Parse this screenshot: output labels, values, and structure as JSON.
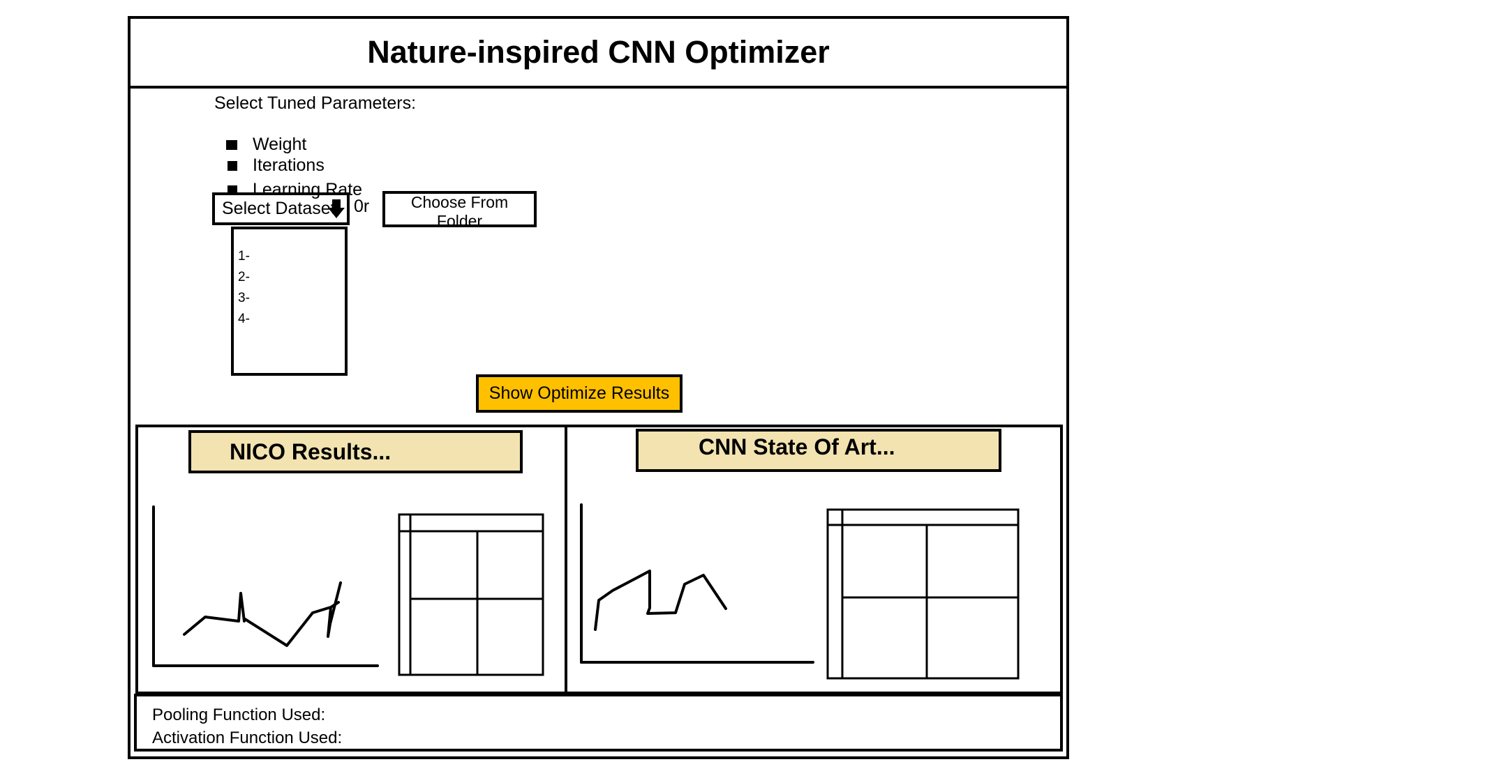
{
  "title": "Nature-inspired CNN Optimizer",
  "params": {
    "label": "Select Tuned Parameters:",
    "items": [
      "Weight",
      "Iterations",
      "Learning Rate"
    ]
  },
  "dataset": {
    "select_label": "Select Dataset",
    "or_text": "0r",
    "folder_button": "Choose From Folder",
    "options": [
      "1-",
      "2-",
      "3-",
      "4-"
    ]
  },
  "show_button": "Show Optimize Results",
  "colors": {
    "button": "#ffc000",
    "header": "#f2e3b0"
  },
  "results": {
    "left_header": "NICO Results...",
    "right_header": "CNN State Of Art..."
  },
  "info": {
    "pooling_label": "Pooling Function Used:",
    "activation_label": "Activation Function Used:"
  },
  "icons": {
    "dropdown": "arrow-down-icon"
  }
}
